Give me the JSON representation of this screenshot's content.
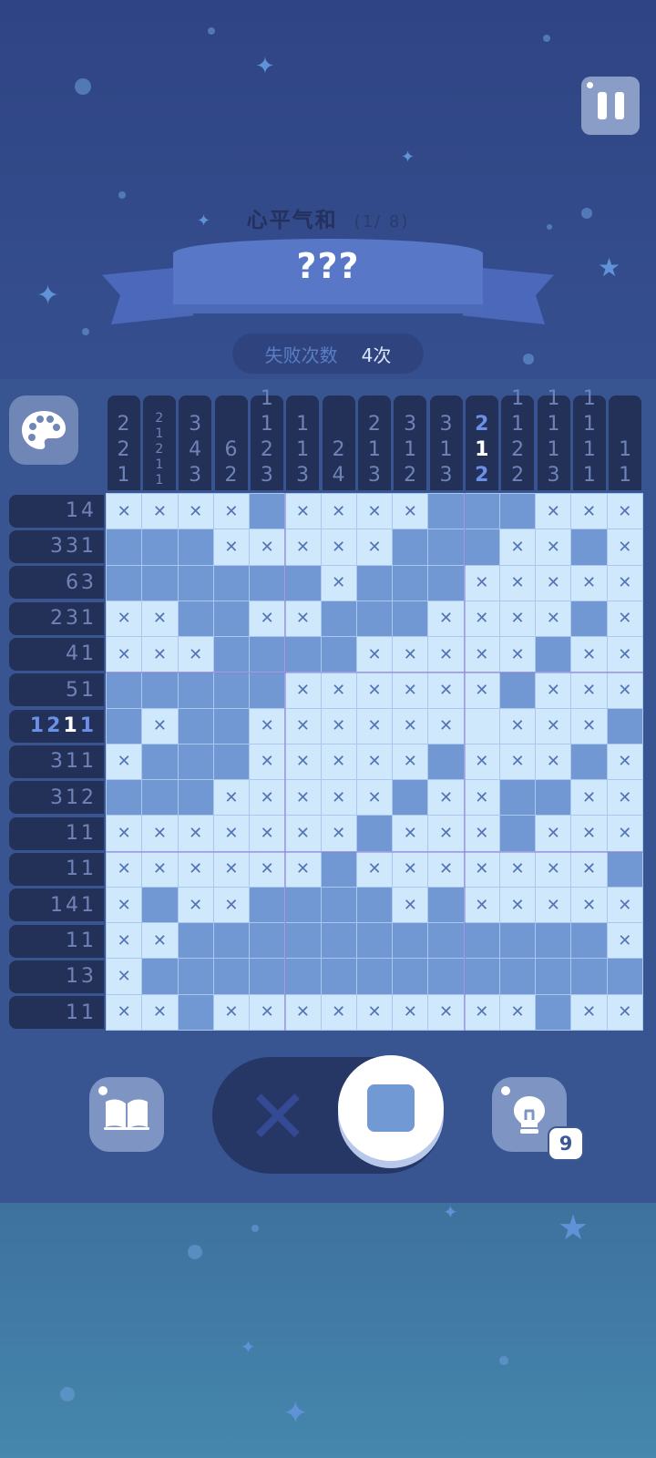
{
  "header": {
    "puzzle_title": "心平气和",
    "progress": "(1/ 8)",
    "banner_text": "???",
    "fail_label": "失败次数",
    "fail_value": "4次"
  },
  "active": {
    "column": 10,
    "row": 6,
    "cursor_clue_index": 1
  },
  "column_clues": [
    [
      "2",
      "2",
      "1"
    ],
    [
      "2",
      "1",
      "2",
      "1",
      "1"
    ],
    [
      "3",
      "4",
      "3"
    ],
    [
      "6",
      "2"
    ],
    [
      "1",
      "1",
      "2",
      "3"
    ],
    [
      "1",
      "1",
      "3"
    ],
    [
      "2",
      "4"
    ],
    [
      "2",
      "1",
      "3"
    ],
    [
      "3",
      "1",
      "2"
    ],
    [
      "3",
      "1",
      "3"
    ],
    [
      "2",
      "1",
      "2"
    ],
    [
      "1",
      "1",
      "2",
      "2"
    ],
    [
      "1",
      "1",
      "1",
      "3"
    ],
    [
      "1",
      "1",
      "1",
      "1"
    ],
    [
      "1",
      "1"
    ]
  ],
  "row_clues": [
    "14",
    "331",
    "63",
    "231",
    "41",
    "51",
    "1211",
    "311",
    "312",
    "11",
    "11",
    "141",
    "11",
    "13",
    "11"
  ],
  "grid": [
    "xxxxfxxxxfffxxx",
    "fffxxxxxfffxxfx",
    "ffffffxfffxxxxx",
    "xxffxxfffxxxxfx",
    "xxxffffxxxxxfxx",
    "fffffxxxxxxfxxx",
    "fxffxxxxxxexxxf",
    "xfffxxxxxfxxxfx",
    "fffxxxxxfxxffxx",
    "xxxxxxxfxxxfxxx",
    "xxxxxxfxxxxxxxf",
    "xfxxffffxfxxxxx",
    "xxffffffffffffx",
    "xffffffffffffffx",
    "xxfxxxxxxxxxfxx"
  ],
  "controls": {
    "cross_symbol": "✕",
    "hint_count": "9",
    "icons": [
      "pause-icon",
      "palette-icon",
      "book-icon",
      "cross-mode-icon",
      "fill-mode-icon",
      "lightbulb-icon"
    ]
  },
  "colors": {
    "filled": "#7198d3",
    "empty": "#cfe8fb",
    "clue_bg": "#233058",
    "active_clue": "#6c8fe8"
  }
}
